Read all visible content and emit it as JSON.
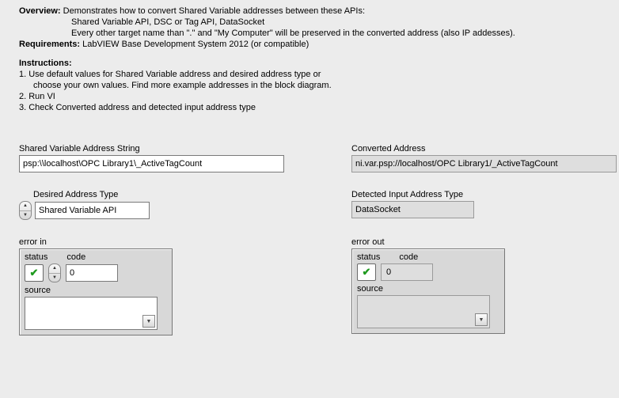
{
  "overview": {
    "label": "Overview:",
    "line1": "Demonstrates how to convert Shared Variable addresses between these APIs:",
    "line2": "Shared Variable API, DSC or Tag API, DataSocket",
    "line3": "Every other target name than \".\" and \"My Computer\" will be preserved in the converted address (also IP addesses)."
  },
  "requirements": {
    "label": "Requirements:",
    "text": "LabVIEW Base Development System 2012 (or compatible)"
  },
  "instructions": {
    "label": "Instructions:",
    "line1": "1. Use default values for Shared Variable address and desired address type or",
    "line1b": "choose your own values. Find more example addresses in the block diagram.",
    "line2": "2. Run VI",
    "line3": "3. Check Converted address and detected input address type"
  },
  "left": {
    "input_label": "Shared Variable Address String",
    "input_value": "psp:\\\\localhost\\OPC Library1\\_ActiveTagCount",
    "type_label": "Desired Address Type",
    "type_value": "Shared Variable API",
    "error_label": "error in",
    "error": {
      "status_label": "status",
      "code_label": "code",
      "code_value": "0",
      "source_label": "source",
      "source_value": ""
    }
  },
  "right": {
    "output_label": "Converted Address",
    "output_value": "ni.var.psp://localhost/OPC Library1/_ActiveTagCount",
    "type_label": "Detected Input Address Type",
    "type_value": "DataSocket",
    "error_label": "error out",
    "error": {
      "status_label": "status",
      "code_label": "code",
      "code_value": "0",
      "source_label": "source",
      "source_value": ""
    }
  }
}
